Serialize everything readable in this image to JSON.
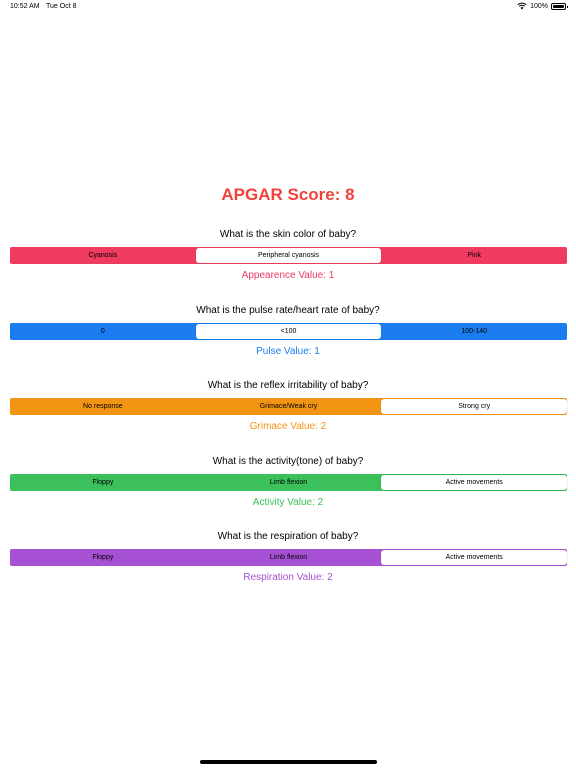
{
  "status_bar": {
    "time": "10:52 AM",
    "date": "Tue Oct 8",
    "battery": "100%",
    "battery_level": 1.0
  },
  "score": {
    "title": "APGAR Score: 8",
    "color": "#f0413a"
  },
  "sections": [
    {
      "question": "What is the skin color of baby?",
      "options": [
        "Cyanosis",
        "Peripheral cyanosis",
        "Pink"
      ],
      "selected_index": 1,
      "value_label": "Appearence Value: 1",
      "color": "#ef3b5f"
    },
    {
      "question": "What is the pulse rate/heart rate of baby?",
      "options": [
        "0",
        "<100",
        "100-140"
      ],
      "selected_index": 1,
      "value_label": "Pulse Value: 1",
      "color": "#1b7cf0"
    },
    {
      "question": "What is the reflex irritability of baby?",
      "options": [
        "No response",
        "Grimace/Weak cry",
        "Strong cry"
      ],
      "selected_index": 2,
      "value_label": "Grimace Value: 2",
      "color": "#f39514"
    },
    {
      "question": "What is the activity(tone) of baby?",
      "options": [
        "Floppy",
        "Limb flexion",
        "Active movements"
      ],
      "selected_index": 2,
      "value_label": "Activity Value: 2",
      "color": "#3bc05b"
    },
    {
      "question": "What is the respiration of baby?",
      "options": [
        "Floppy",
        "Limb flexion",
        "Active movements"
      ],
      "selected_index": 2,
      "value_label": "Respiration Value: 2",
      "color": "#a650d3"
    }
  ]
}
